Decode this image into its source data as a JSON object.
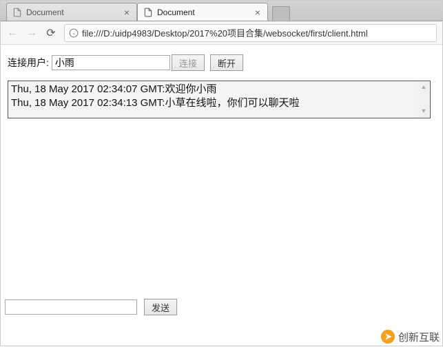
{
  "browser": {
    "tabs": [
      {
        "title": "Document",
        "active": false
      },
      {
        "title": "Document",
        "active": true
      }
    ],
    "url": "file:///D:/uidp4983/Desktop/2017%20项目合集/websocket/first/client.html"
  },
  "form": {
    "user_label": "连接用户:",
    "user_value": "小雨",
    "connect_label": "连接",
    "disconnect_label": "断开",
    "send_label": "发送",
    "message_value": ""
  },
  "log": {
    "lines": [
      "Thu, 18 May 2017 02:34:07 GMT:欢迎你小雨",
      "Thu, 18 May 2017 02:34:13 GMT:小草在线啦，你们可以聊天啦"
    ]
  },
  "watermark": {
    "text": "创新互联"
  }
}
